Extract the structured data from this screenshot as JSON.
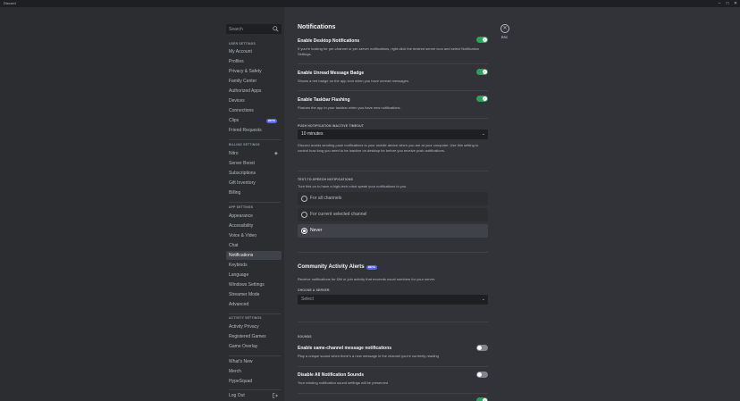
{
  "titlebar": {
    "app_name": "Discord",
    "minimize": "–",
    "maximize": "□",
    "close": "✕"
  },
  "search": {
    "placeholder": "Search"
  },
  "sidebar": {
    "user_header": "USER SETTINGS",
    "user_items": [
      "My Account",
      "Profiles",
      "Privacy & Safety",
      "Family Center",
      "Authorized Apps",
      "Devices",
      "Connections",
      "Clips",
      "Friend Requests"
    ],
    "clips_badge": "BETA",
    "billing_header": "BILLING SETTINGS",
    "billing_items": [
      "Nitro",
      "Server Boost",
      "Subscriptions",
      "Gift Inventory",
      "Billing"
    ],
    "app_header": "APP SETTINGS",
    "app_items": [
      "Appearance",
      "Accessibility",
      "Voice & Video",
      "Chat",
      "Notifications",
      "Keybinds",
      "Language",
      "Windows Settings",
      "Streamer Mode",
      "Advanced"
    ],
    "selected_item": "Notifications",
    "activity_header": "ACTIVITY SETTINGS",
    "activity_items": [
      "Activity Privacy",
      "Registered Games",
      "Game Overlay"
    ],
    "misc_items": [
      "What's New",
      "Merch",
      "HypeSquad"
    ],
    "logout": "Log Out"
  },
  "main": {
    "title": "Notifications",
    "desktop": {
      "title": "Enable Desktop Notifications",
      "desc": "If you're looking for per-channel or per-server notifications, right-click the desired server icon and select Notification Settings.",
      "enabled": true
    },
    "unread": {
      "title": "Enable Unread Message Badge",
      "desc": "Shows a red badge on the app icon when you have unread messages.",
      "enabled": true
    },
    "taskbar": {
      "title": "Enable Taskbar Flashing",
      "desc": "Flashes the app in your taskbar when you have new notifications.",
      "enabled": true
    },
    "push": {
      "label": "PUSH NOTIFICATION INACTIVE TIMEOUT",
      "value": "10 minutes",
      "desc": "Discord avoids sending push notifications to your mobile device when you are at your computer. Use this setting to control how long you need to be inactive on desktop for before you receive push notifications."
    },
    "tts": {
      "label": "TEXT-TO-SPEECH NOTIFICATIONS",
      "desc": "Turn this on to have a high-tech robot speak your notifications to you.",
      "options": [
        "For all channels",
        "For current selected channel",
        "Never"
      ],
      "selected": "Never"
    },
    "community": {
      "title": "Community Activity Alerts",
      "badge": "BETA",
      "desc": "Receive notifications for DM or join activity that exceeds usual numbers for your server.",
      "server_label": "CHOOSE A SERVER",
      "server_placeholder": "Select"
    },
    "sounds": {
      "label": "SOUNDS",
      "same_channel": {
        "title": "Enable same-channel message notifications",
        "desc": "Play a unique sound when there's a new message in the channel you're currently reading",
        "enabled": false
      },
      "disable_all": {
        "title": "Disable All Notification Sounds",
        "desc": "Your existing notification sound settings will be preserved",
        "enabled": false
      }
    },
    "esc_label": "ESC",
    "esc_icon": "✕"
  },
  "colors": {
    "accent": "#5865f2",
    "toggle_on": "#23a55a",
    "toggle_off": "#80848e",
    "background": "#313338",
    "sidebar": "#2b2d31"
  }
}
